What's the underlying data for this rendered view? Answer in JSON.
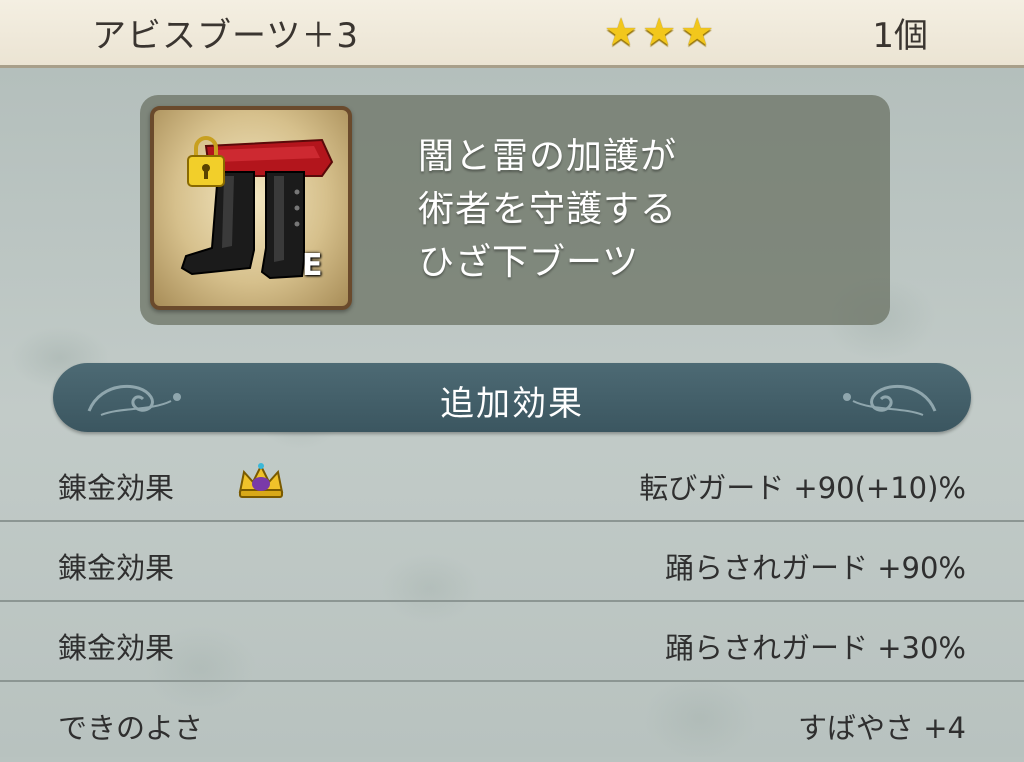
{
  "header": {
    "item_name": "アビスブーツ＋3",
    "stars": 3,
    "quantity": "1個"
  },
  "item": {
    "icon": "knee-boots-icon",
    "equipped_mark": "E",
    "locked": true,
    "description_lines": [
      "闇と雷の加護が",
      "術者を守護する",
      "ひざ下ブーツ"
    ]
  },
  "section": {
    "title": "追加効果"
  },
  "effects": [
    {
      "label": "錬金効果",
      "value": "転びガード +90(+10)%",
      "badge": "crown-icon"
    },
    {
      "label": "錬金効果",
      "value": "踊らされガード +90%"
    },
    {
      "label": "錬金効果",
      "value": "踊らされガード +30%"
    },
    {
      "label": "できのよさ",
      "value": "すばやさ +4"
    }
  ],
  "colors": {
    "header_bg": "#f0eadb",
    "section_bar": "#44606a",
    "star": "#f2c71c",
    "text_dark": "#2f2f2f"
  }
}
